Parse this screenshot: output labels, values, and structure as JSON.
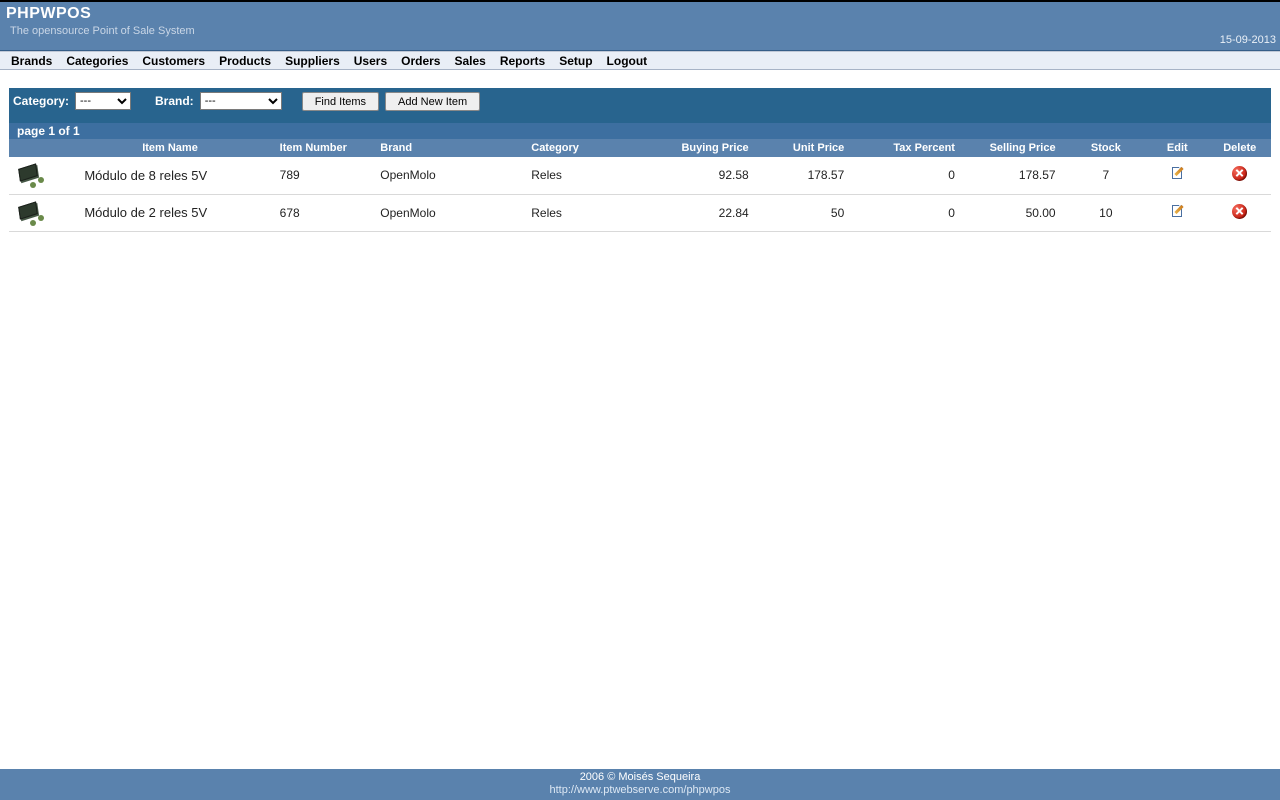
{
  "header": {
    "title": "PHPWPOS",
    "subtitle": "The opensource Point of Sale System",
    "date": "15-09-2013"
  },
  "menu": [
    "Brands",
    "Categories",
    "Customers",
    "Products",
    "Suppliers",
    "Users",
    "Orders",
    "Sales",
    "Reports",
    "Setup",
    "Logout"
  ],
  "filter": {
    "category_label": "Category:",
    "category_value": "---",
    "brand_label": "Brand:",
    "brand_value": "---",
    "find_label": "Find Items",
    "add_label": "Add New Item"
  },
  "pager": "page 1 of 1",
  "columns": {
    "item_name": "Item Name",
    "item_number": "Item Number",
    "brand": "Brand",
    "category": "Category",
    "buying_price": "Buying Price",
    "unit_price": "Unit Price",
    "tax_percent": "Tax Percent",
    "selling_price": "Selling Price",
    "stock": "Stock",
    "edit": "Edit",
    "delete": "Delete"
  },
  "rows": [
    {
      "name": "Módulo de 8 reles 5V",
      "item_number": "789",
      "brand": "OpenMolo",
      "category": "Reles",
      "buying_price": "92.58",
      "unit_price": "178.57",
      "tax_percent": "0",
      "selling_price": "178.57",
      "stock": "7"
    },
    {
      "name": "Módulo de 2 reles 5V",
      "item_number": "678",
      "brand": "OpenMolo",
      "category": "Reles",
      "buying_price": "22.84",
      "unit_price": "50",
      "tax_percent": "0",
      "selling_price": "50.00",
      "stock": "10"
    }
  ],
  "footer": {
    "copyright": "2006 © Moisés Sequeira",
    "url": "http://www.ptwebserve.com/phpwpos"
  }
}
